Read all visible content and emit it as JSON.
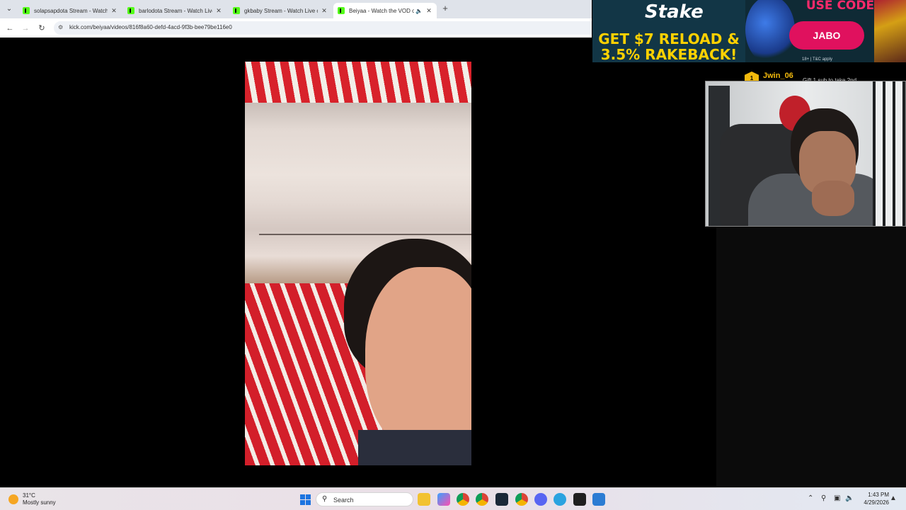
{
  "browser": {
    "tabs": [
      {
        "title": "solapsapdota Stream - Watch L",
        "active": false
      },
      {
        "title": "barlodota Stream - Watch Live",
        "active": false
      },
      {
        "title": "gkbaby Stream - Watch Live on",
        "active": false
      },
      {
        "title": "Beiyaa - Watch the VOD on",
        "active": true
      }
    ],
    "url": "kick.com/beiyaa/videos/816f8a60-defd-4acd-9f3b-bee79be116e0"
  },
  "ad": {
    "brand": "Stake",
    "headline": "GET $7 RELOAD & 3.5% RAKEBACK!",
    "use_code_label": "USE CODE",
    "code": "JABO",
    "terms": "18+ | T&C apply"
  },
  "sub_notice": {
    "badge": "1",
    "user": "Jwin_06",
    "text": "Gift 1 sub to take 2nd"
  },
  "taskbar": {
    "weather_temp": "31°C",
    "weather_desc": "Mostly sunny",
    "search_placeholder": "Search",
    "time": "1:43 PM",
    "date": "4/29/2026"
  },
  "colors": {
    "kick_green": "#53fc18",
    "stake_yellow": "#ffd100",
    "stake_pink": "#e0115e"
  }
}
